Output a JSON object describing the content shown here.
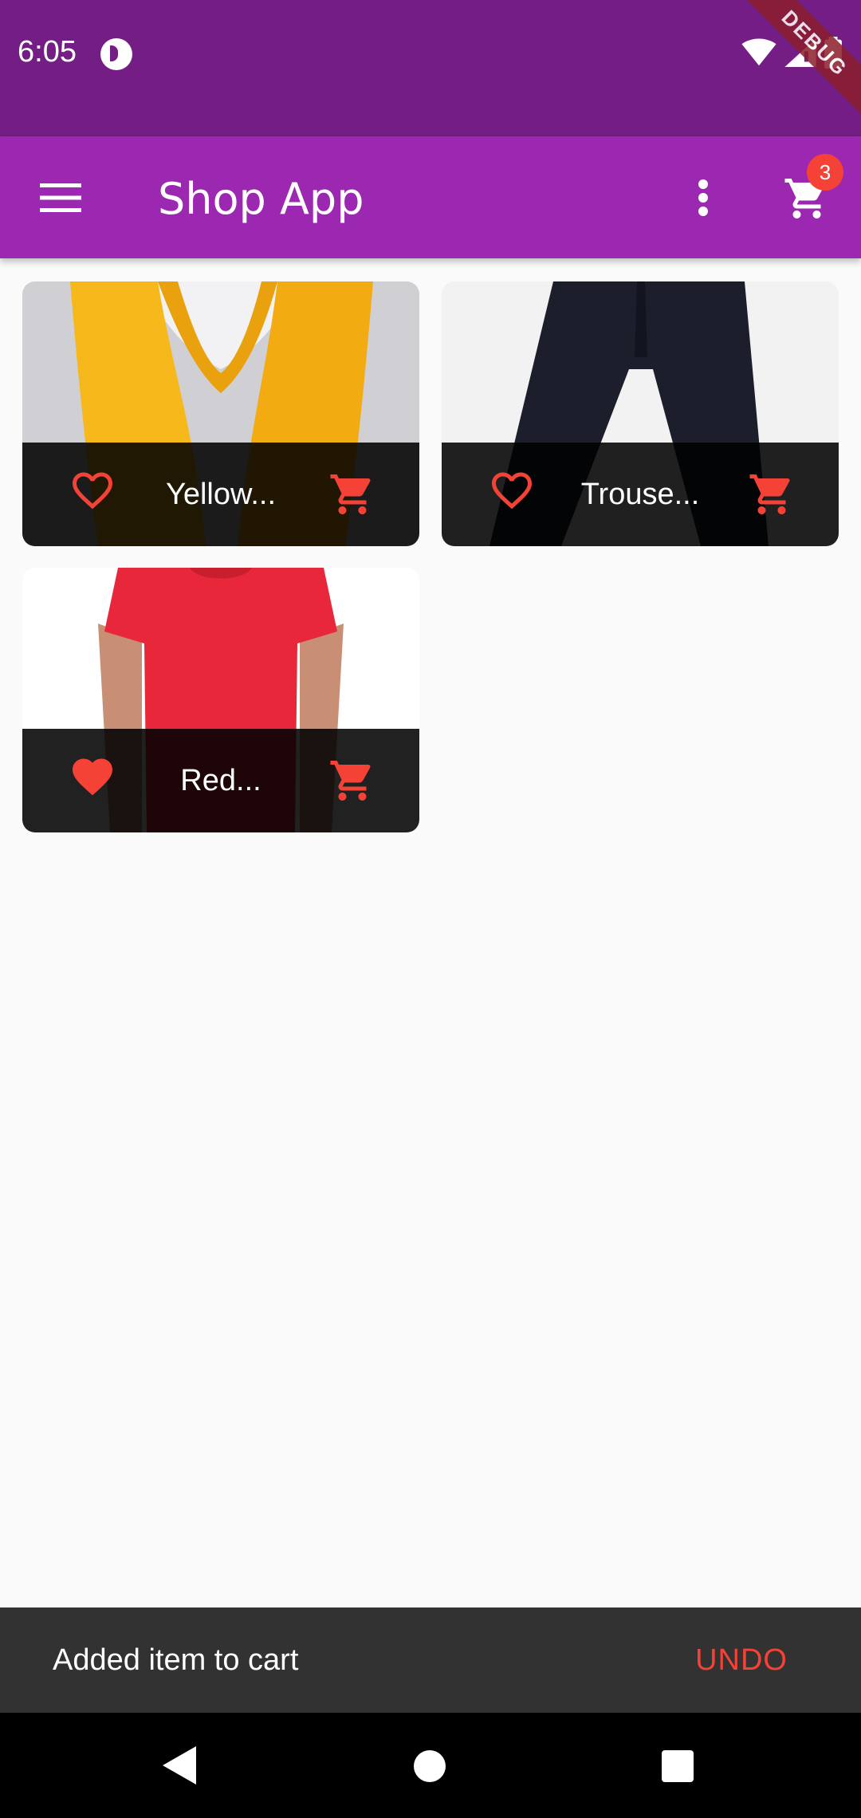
{
  "status_bar": {
    "time": "6:05",
    "debug_label": "DEBUG"
  },
  "app_bar": {
    "title": "Shop App",
    "cart_count": "3"
  },
  "products": [
    {
      "title": "Yellow...",
      "favorite": false
    },
    {
      "title": "Trouse...",
      "favorite": false
    },
    {
      "title": "Red...",
      "favorite": true
    }
  ],
  "snackbar": {
    "message": "Added item to cart",
    "action": "UNDO"
  },
  "colors": {
    "primary": "#9c27b0",
    "primary_dark": "#741d84",
    "accent": "#f44336"
  },
  "icons": [
    "menu-icon",
    "more-vert-icon",
    "shopping-cart-icon",
    "favorite-icon",
    "favorite-border-icon"
  ]
}
